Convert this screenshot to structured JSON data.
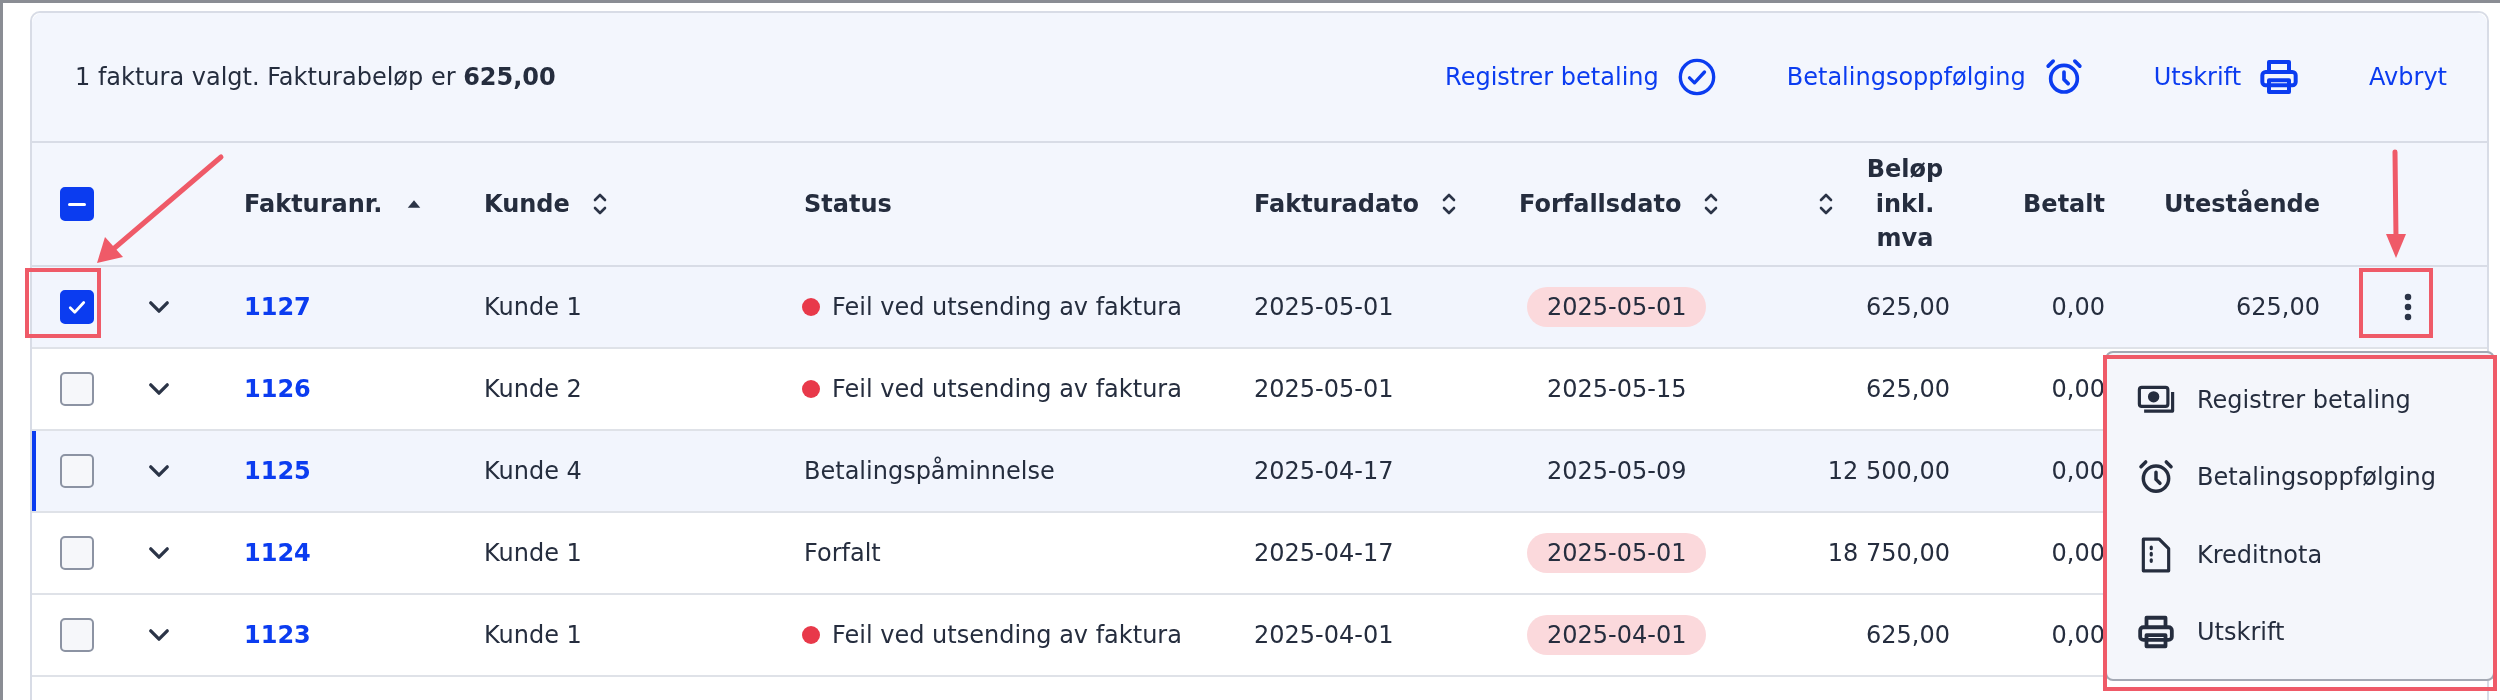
{
  "selection_bar": {
    "summary": "1 faktura valgt. Fakturabeløp er **625,00**",
    "actions": [
      {
        "label": "Registrer betaling"
      },
      {
        "label": "Betalingsoppfølging"
      },
      {
        "label": "Utskrift"
      },
      {
        "label": "Avbryt"
      }
    ]
  },
  "table": {
    "select_all": {
      "indeterminate": true
    },
    "columns": [
      {
        "label": "Fakturanr.",
        "sortable": true,
        "sorted": true
      },
      {
        "label": "Kunde",
        "sortable": true,
        "sorted": false
      },
      {
        "label": "Status",
        "sortable": false
      },
      {
        "label": "Fakturadato",
        "sortable": true,
        "sorted": false
      },
      {
        "label": "Forfallsdato",
        "sortable": true,
        "sorted": false
      },
      {
        "label": "Beløp inkl. mva",
        "sortable": true,
        "sorted": false
      },
      {
        "label": "Betalt",
        "sortable": false
      },
      {
        "label": "Utestående",
        "sortable": false
      }
    ],
    "rows": [
      {
        "checked": true,
        "focused": false,
        "number": "1127",
        "customer": "Kunde 1",
        "status": "Feil ved utsending av faktura",
        "error": true,
        "invoice_date": "2025-05-01",
        "due_date": "2025-05-01",
        "overdue": true,
        "amount": "625,00",
        "paid": "0,00",
        "outstanding": "625,00"
      },
      {
        "checked": false,
        "focused": false,
        "number": "1126",
        "customer": "Kunde 2",
        "status": "Feil ved utsending av faktura",
        "error": true,
        "invoice_date": "2025-05-01",
        "due_date": "2025-05-15",
        "overdue": false,
        "amount": "625,00",
        "paid": "0,00"
      },
      {
        "checked": false,
        "focused": true,
        "number": "1125",
        "customer": "Kunde 4",
        "status": "Betalingspåminnelse",
        "error": false,
        "invoice_date": "2025-04-17",
        "due_date": "2025-05-09",
        "overdue": false,
        "amount": "12 500,00",
        "paid": "0,00"
      },
      {
        "checked": false,
        "focused": false,
        "number": "1124",
        "customer": "Kunde 1",
        "status": "Forfalt",
        "error": false,
        "invoice_date": "2025-04-17",
        "due_date": "2025-05-01",
        "overdue": true,
        "amount": "18 750,00",
        "paid": "0,00"
      },
      {
        "checked": false,
        "focused": false,
        "number": "1123",
        "customer": "Kunde 1",
        "status": "Feil ved utsending av faktura",
        "error": true,
        "invoice_date": "2025-04-01",
        "due_date": "2025-04-01",
        "overdue": true,
        "amount": "625,00",
        "paid": "0,00"
      }
    ]
  },
  "row_menu": {
    "items": [
      {
        "label": "Registrer betaling"
      },
      {
        "label": "Betalingsoppfølging"
      },
      {
        "label": "Kreditnota"
      },
      {
        "label": "Utskrift"
      }
    ]
  }
}
